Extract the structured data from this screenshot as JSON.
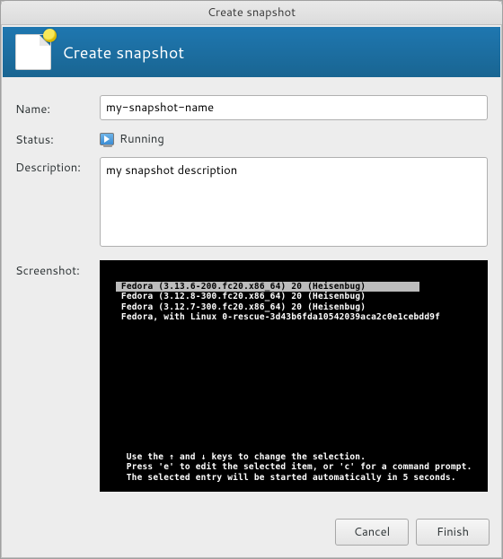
{
  "window": {
    "title": "Create snapshot"
  },
  "banner": {
    "title": "Create snapshot"
  },
  "form": {
    "name_label": "Name:",
    "name_value": "my-snapshot-name",
    "status_label": "Status:",
    "status_value": "Running",
    "description_label": "Description:",
    "description_value": "my snapshot description",
    "screenshot_label": "Screenshot:"
  },
  "boot": {
    "entries": [
      {
        "text": " Fedora (3.13.6-200.fc20.x86_64) 20 (Heisenbug)",
        "selected": true
      },
      {
        "text": " Fedora (3.12.8-300.fc20.x86_64) 20 (Heisenbug)",
        "selected": false
      },
      {
        "text": " Fedora (3.12.7-300.fc20.x86_64) 20 (Heisenbug)",
        "selected": false
      },
      {
        "text": " Fedora, with Linux 0-rescue-3d43b6fda10542039aca2c0e1cebdd9f",
        "selected": false
      }
    ],
    "hint_line1": "   Use the ↑ and ↓ keys to change the selection.",
    "hint_line2": "   Press 'e' to edit the selected item, or 'c' for a command prompt.",
    "hint_line3": "   The selected entry will be started automatically in 5 seconds."
  },
  "buttons": {
    "cancel": "Cancel",
    "finish": "Finish"
  }
}
